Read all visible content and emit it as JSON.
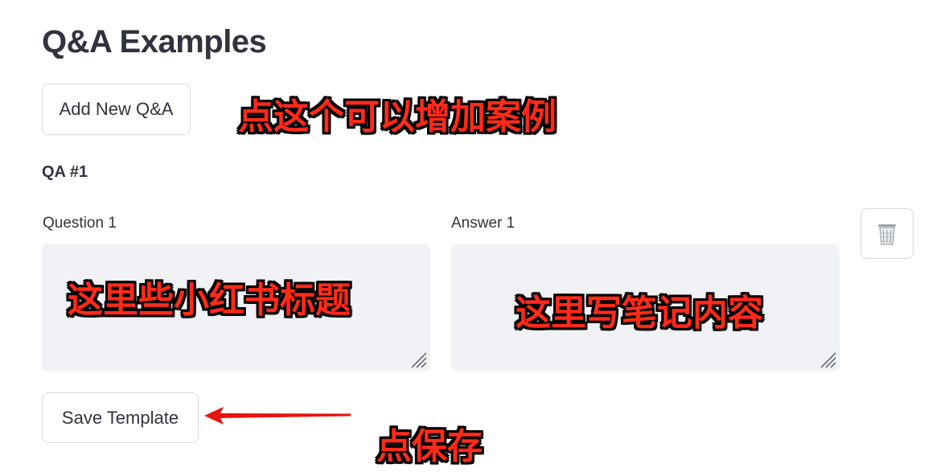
{
  "page": {
    "title": "Q&A Examples"
  },
  "toolbar": {
    "add_label": "Add New Q&A",
    "save_label": "Save Template"
  },
  "qa": [
    {
      "heading": "QA #1",
      "question_label": "Question 1",
      "question_value": "",
      "answer_label": "Answer 1",
      "answer_value": "",
      "delete_icon": "trash-icon"
    }
  ],
  "annotations": {
    "add_hint": "点这个可以增加案例",
    "question_hint": "这里些小红书标题",
    "answer_hint": "这里写笔记内容",
    "save_hint": "点保存"
  },
  "colors": {
    "text": "#31333f",
    "field_bg": "#f0f2f6",
    "button_border": "#d6d8de",
    "annotation_red": "#ff2a1a",
    "annotation_outline": "#000000",
    "arrow_red": "#e8130e"
  }
}
